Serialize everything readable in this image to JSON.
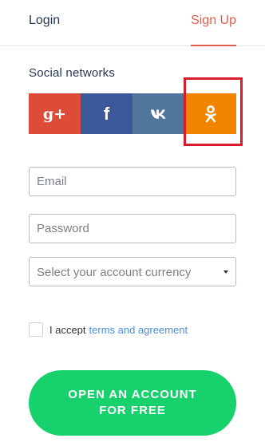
{
  "tabs": {
    "login": "Login",
    "signup": "Sign Up"
  },
  "social": {
    "title": "Social networks",
    "buttons": [
      {
        "label": "g+",
        "icon": "google-plus-icon",
        "color": "#dd4b39"
      },
      {
        "label": "f",
        "icon": "facebook-icon",
        "color": "#3b5998"
      },
      {
        "label": "vk",
        "icon": "vk-icon",
        "color": "#52779f"
      },
      {
        "label": "ok",
        "icon": "odnoklassniki-icon",
        "color": "#f28400"
      }
    ]
  },
  "form": {
    "email_placeholder": "Email",
    "password_placeholder": "Password",
    "currency_placeholder": "Select your account currency"
  },
  "agreement": {
    "text": "I accept",
    "link": "terms and agreement"
  },
  "cta": {
    "line1": "OPEN AN ACCOUNT",
    "line2": "FOR FREE"
  },
  "colors": {
    "accent": "#e25d4b",
    "cta": "#16d16c",
    "link": "#4a90d9",
    "highlight": "#d81d2a"
  }
}
